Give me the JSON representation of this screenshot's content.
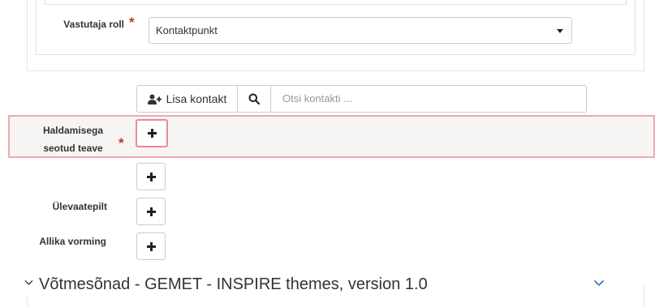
{
  "contact": {
    "role_label": "Vastutaja roll",
    "required_mark": "*",
    "role_value": "Kontaktpunkt",
    "add_contact_label": "Lisa kontakt",
    "search_placeholder": "Otsi kontakti ..."
  },
  "fields": {
    "management_info_label_line1": "Haldamisega",
    "management_info_label_line2": "seotud teave",
    "required_mark": "*",
    "overview_label": "Ülevaatepilt",
    "source_format_label": "Allika vorming"
  },
  "section": {
    "title": "Võtmesõnad - GEMET - INSPIRE themes, version 1.0"
  },
  "icons": {
    "add_contact": "user-plus-icon",
    "search": "search-icon",
    "add": "plus-icon",
    "collapse_small": "chevron-down-icon",
    "collapse_right": "chevron-down-icon"
  },
  "colors": {
    "required": "#c0392b",
    "highlight_border": "#efa8ae",
    "highlight_bg": "#f6f5f4",
    "chevron_blue": "#3a7bbf"
  }
}
